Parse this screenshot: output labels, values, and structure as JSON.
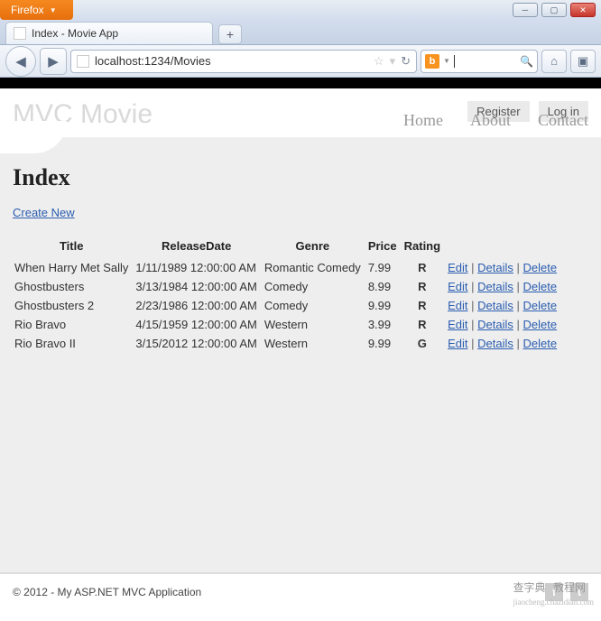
{
  "browser": {
    "name": "Firefox",
    "tab_title": "Index - Movie App",
    "url": "localhost:1234/Movies"
  },
  "header": {
    "brand": "MVC Movie",
    "register": "Register",
    "login": "Log in",
    "nav": {
      "home": "Home",
      "about": "About",
      "contact": "Contact"
    }
  },
  "page": {
    "heading": "Index",
    "create_link": "Create New",
    "columns": {
      "title": "Title",
      "release": "ReleaseDate",
      "genre": "Genre",
      "price": "Price",
      "rating": "Rating"
    },
    "actions": {
      "edit": "Edit",
      "details": "Details",
      "delete": "Delete"
    },
    "rows": [
      {
        "title": "When Harry Met Sally",
        "release": "1/11/1989 12:00:00 AM",
        "genre": "Romantic Comedy",
        "price": "7.99",
        "rating": "R"
      },
      {
        "title": "Ghostbusters",
        "release": "3/13/1984 12:00:00 AM",
        "genre": "Comedy",
        "price": "8.99",
        "rating": "R"
      },
      {
        "title": "Ghostbusters 2",
        "release": "2/23/1986 12:00:00 AM",
        "genre": "Comedy",
        "price": "9.99",
        "rating": "R"
      },
      {
        "title": "Rio Bravo",
        "release": "4/15/1959 12:00:00 AM",
        "genre": "Western",
        "price": "3.99",
        "rating": "R"
      },
      {
        "title": "Rio Bravo II",
        "release": "3/15/2012 12:00:00 AM",
        "genre": "Western",
        "price": "9.99",
        "rating": "G"
      }
    ]
  },
  "footer": {
    "copyright": "© 2012 - My ASP.NET MVC Application"
  },
  "watermark": {
    "main": "查字典",
    "sep": "教程网",
    "sub": "jiaocheng.chazidian.com"
  }
}
